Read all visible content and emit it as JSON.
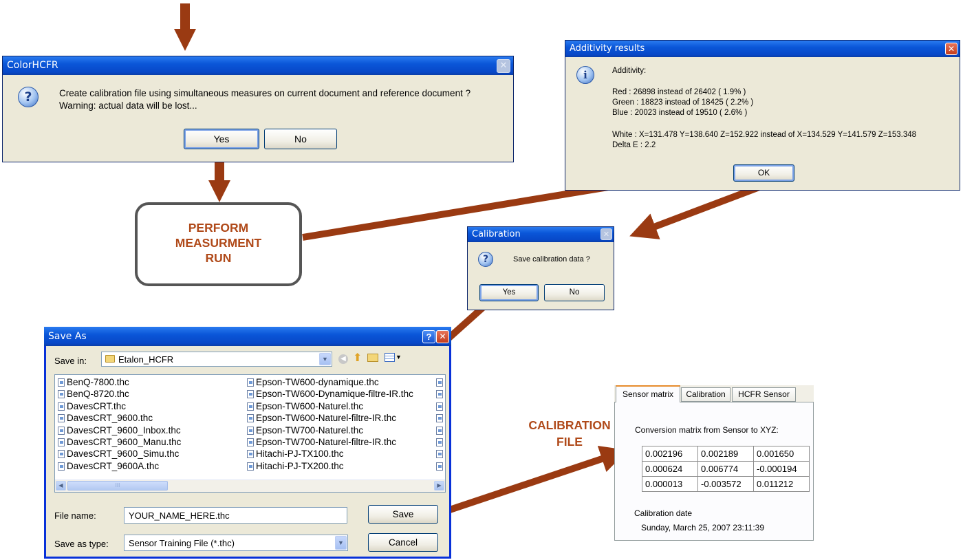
{
  "colorhcfr_dialog": {
    "title": "ColorHCFR",
    "message_line1": "Create calibration file using simultaneous measures on current document and reference document ?",
    "message_line2": "Warning: actual data will be lost...",
    "yes_label": "Yes",
    "no_label": "No"
  },
  "additivity_dialog": {
    "title": "Additivity results",
    "heading": "Additivity:",
    "red_line": "Red : 26898 instead of 26402 ( 1.9% )",
    "green_line": "Green : 18823 instead of 18425 ( 2.2% )",
    "blue_line": "Blue : 20023 instead of 19510 ( 2.6% )",
    "white_line": "White : X=131.478 Y=138.640 Z=152.922 instead of X=134.529 Y=141.579 Z=153.348",
    "delta_line": "Delta E : 2.2",
    "ok_label": "OK"
  },
  "flow_box": {
    "line1": "PERFORM",
    "line2": "MEASURMENT",
    "line3": "RUN"
  },
  "calibration_dialog": {
    "title": "Calibration",
    "message": "Save calibration data ?",
    "yes_label": "Yes",
    "no_label": "No"
  },
  "save_as_dialog": {
    "title": "Save As",
    "save_in_label": "Save in:",
    "folder": "Etalon_HCFR",
    "files_col1": [
      "BenQ-7800.thc",
      "BenQ-8720.thc",
      "DavesCRT.thc",
      "DavesCRT_9600.thc",
      "DavesCRT_9600_Inbox.thc",
      "DavesCRT_9600_Manu.thc",
      "DavesCRT_9600_Simu.thc",
      "DavesCRT_9600A.thc"
    ],
    "files_col2": [
      "Epson-TW600-dynamique.thc",
      "Epson-TW600-Dynamique-filtre-IR.thc",
      "Epson-TW600-Naturel.thc",
      "Epson-TW600-Naturel-filtre-IR.thc",
      "Epson-TW700-Naturel.thc",
      "Epson-TW700-Naturel-filtre-IR.thc",
      "Hitachi-PJ-TX100.thc",
      "Hitachi-PJ-TX200.thc"
    ],
    "file_name_label": "File name:",
    "file_name_value": "YOUR_NAME_HERE.thc",
    "save_type_label": "Save as type:",
    "save_type_value": "Sensor Training File (*.thc)",
    "save_label": "Save",
    "cancel_label": "Cancel",
    "scroll_grip": "III"
  },
  "calibration_file_label": {
    "line1": "CALIBRATION",
    "line2": "FILE"
  },
  "sensor_panel": {
    "tabs": [
      "Sensor matrix",
      "Calibration",
      "HCFR Sensor"
    ],
    "heading": "Conversion matrix from Sensor to XYZ:",
    "matrix": [
      [
        "0.002196",
        "0.002189",
        "0.001650"
      ],
      [
        "0.000624",
        "0.006774",
        "-0.000194"
      ],
      [
        "0.000013",
        "-0.003572",
        "0.011212"
      ]
    ],
    "date_label": "Calibration date",
    "date_value": "Sunday, March 25, 2007 23:11:39"
  },
  "colors": {
    "arrow": "#9a3a12",
    "label": "#b04a1a",
    "xp_title": "#0a56d8",
    "dialog_bg": "#ece9d8"
  }
}
